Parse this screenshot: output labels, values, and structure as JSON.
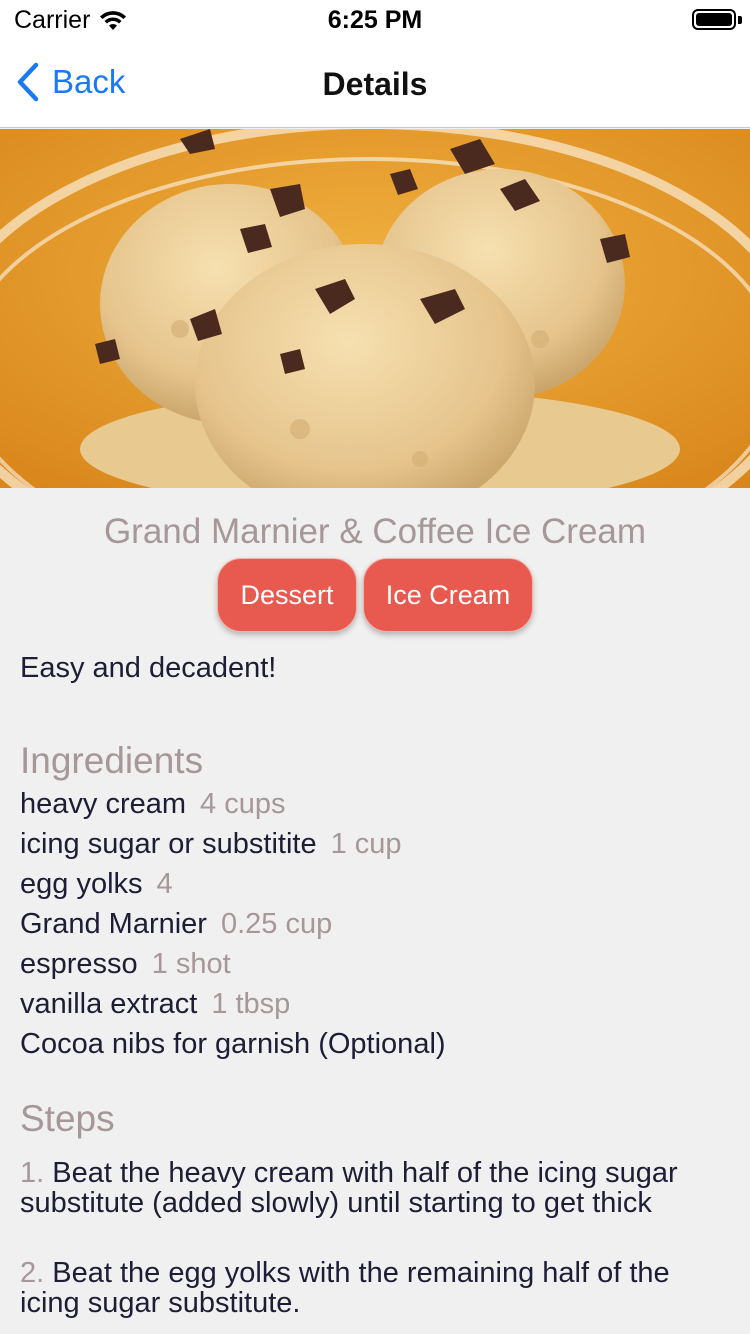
{
  "status_bar": {
    "carrier": "Carrier",
    "time": "6:25 PM",
    "battery_level": 1.0
  },
  "nav": {
    "back_label": "Back",
    "title": "Details",
    "accent_color": "#1a7af5"
  },
  "hero_image": {
    "subject": "ice cream scoops with cocoa nibs in a glass bowl"
  },
  "recipe": {
    "title": "Grand Marnier & Coffee Ice Cream",
    "tags": [
      "Dessert",
      "Ice Cream"
    ],
    "tag_color": "#e85a4f",
    "description": "Easy and decadent!",
    "ingredients_heading": "Ingredients",
    "ingredients": [
      {
        "name": "heavy cream",
        "qty": "4 cups"
      },
      {
        "name": "icing sugar or substitite",
        "qty": "1 cup"
      },
      {
        "name": "egg yolks",
        "qty": "4"
      },
      {
        "name": "Grand Marnier",
        "qty": "0.25 cup"
      },
      {
        "name": "espresso",
        "qty": "1 shot"
      },
      {
        "name": "vanilla extract",
        "qty": "1 tbsp"
      },
      {
        "name": "Cocoa nibs for garnish (Optional)",
        "qty": ""
      }
    ],
    "steps_heading": "Steps",
    "steps": [
      {
        "num": "1.",
        "text": "Beat the heavy cream with half of the icing sugar substitute (added slowly) until starting to get thick"
      },
      {
        "num": "2.",
        "text": "Beat the egg yolks with the remaining half of the icing sugar substitute."
      }
    ]
  }
}
